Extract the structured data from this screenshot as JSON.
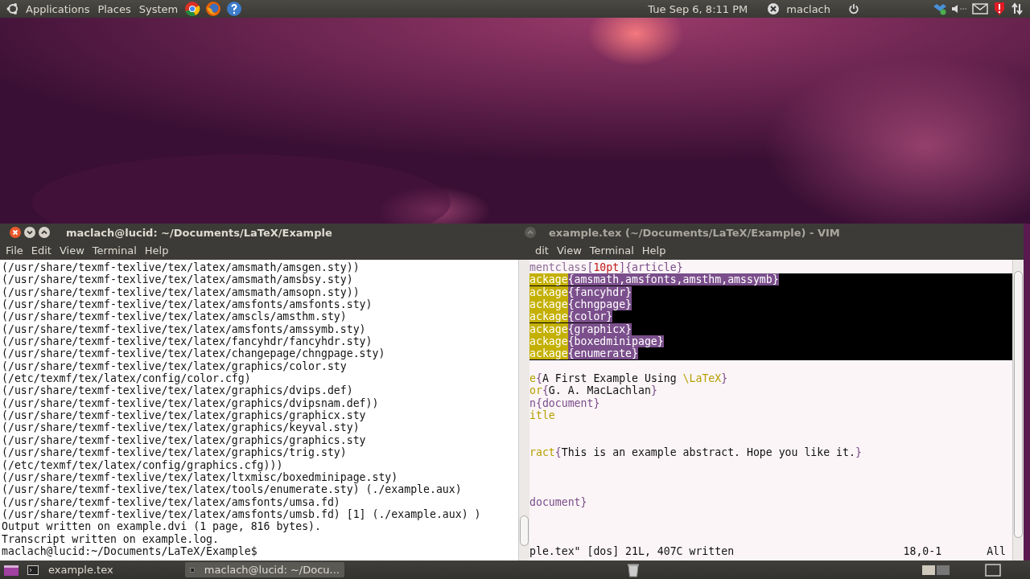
{
  "top_panel": {
    "menus": [
      "Applications",
      "Places",
      "System"
    ],
    "clock": "Tue Sep  6,  8:11 PM",
    "user": "maclach"
  },
  "terminal": {
    "title": "maclach@lucid: ~/Documents/LaTeX/Example",
    "menu": [
      "File",
      "Edit",
      "View",
      "Terminal",
      "Help"
    ],
    "lines": [
      "(/usr/share/texmf-texlive/tex/latex/amsmath/amsgen.sty))",
      "(/usr/share/texmf-texlive/tex/latex/amsmath/amsbsy.sty)",
      "(/usr/share/texmf-texlive/tex/latex/amsmath/amsopn.sty))",
      "(/usr/share/texmf-texlive/tex/latex/amsfonts/amsfonts.sty)",
      "(/usr/share/texmf-texlive/tex/latex/amscls/amsthm.sty)",
      "(/usr/share/texmf-texlive/tex/latex/amsfonts/amssymb.sty)",
      "(/usr/share/texmf-texlive/tex/latex/fancyhdr/fancyhdr.sty)",
      "(/usr/share/texmf-texlive/tex/latex/changepage/chngpage.sty)",
      "(/usr/share/texmf-texlive/tex/latex/graphics/color.sty",
      "(/etc/texmf/tex/latex/config/color.cfg)",
      "(/usr/share/texmf-texlive/tex/latex/graphics/dvips.def)",
      "(/usr/share/texmf-texlive/tex/latex/graphics/dvipsnam.def))",
      "(/usr/share/texmf-texlive/tex/latex/graphics/graphicx.sty",
      "(/usr/share/texmf-texlive/tex/latex/graphics/keyval.sty)",
      "(/usr/share/texmf-texlive/tex/latex/graphics/graphics.sty",
      "(/usr/share/texmf-texlive/tex/latex/graphics/trig.sty)",
      "(/etc/texmf/tex/latex/config/graphics.cfg)))",
      "(/usr/share/texmf-texlive/tex/latex/ltxmisc/boxedminipage.sty)",
      "(/usr/share/texmf-texlive/tex/latex/tools/enumerate.sty) (./example.aux)",
      "(/usr/share/texmf-texlive/tex/latex/amsfonts/umsa.fd)",
      "(/usr/share/texmf-texlive/tex/latex/amsfonts/umsb.fd) [1] (./example.aux) )",
      "Output written on example.dvi (1 page, 816 bytes).",
      "Transcript written on example.log.",
      "maclach@lucid:~/Documents/LaTeX/Example$"
    ]
  },
  "vim": {
    "title": "example.tex (~/Documents/LaTeX/Example) - VIM",
    "menu": [
      "dit",
      "View",
      "Terminal",
      "Help"
    ],
    "lines": [
      {
        "kind": "code",
        "segments": [
          {
            "text": "mentclass",
            "kind": "special"
          },
          {
            "text": "[",
            "kind": "delim"
          },
          {
            "text": "10pt",
            "kind": "number"
          },
          {
            "text": "]{article}",
            "kind": "delim"
          }
        ]
      },
      {
        "kind": "highlighted",
        "segments": [
          {
            "text": "ackage",
            "kind": "statement"
          },
          {
            "text": "{amsmath,amsfonts,amsthm,amssymb}",
            "kind": "delim"
          }
        ]
      },
      {
        "kind": "highlighted",
        "segments": [
          {
            "text": "ackage",
            "kind": "statement"
          },
          {
            "text": "{fancyhdr}",
            "kind": "delim"
          }
        ]
      },
      {
        "kind": "highlighted",
        "segments": [
          {
            "text": "ackage",
            "kind": "statement"
          },
          {
            "text": "{chngpage}",
            "kind": "delim"
          }
        ]
      },
      {
        "kind": "highlighted",
        "segments": [
          {
            "text": "ackage",
            "kind": "statement"
          },
          {
            "text": "{color}",
            "kind": "delim"
          }
        ]
      },
      {
        "kind": "highlighted",
        "segments": [
          {
            "text": "ackage",
            "kind": "statement"
          },
          {
            "text": "{graphicx}",
            "kind": "delim"
          }
        ]
      },
      {
        "kind": "highlighted",
        "segments": [
          {
            "text": "ackage",
            "kind": "statement"
          },
          {
            "text": "{boxedminipage}",
            "kind": "delim"
          }
        ]
      },
      {
        "kind": "highlighted",
        "segments": [
          {
            "text": "ackage",
            "kind": "statement"
          },
          {
            "text": "{enumerate}",
            "kind": "delim"
          }
        ]
      },
      {
        "kind": "blank"
      },
      {
        "kind": "code",
        "segments": [
          {
            "text": "e",
            "kind": "statement"
          },
          {
            "text": "{",
            "kind": "delim"
          },
          {
            "text": "A First Example Using ",
            "kind": "plain"
          },
          {
            "text": "\\LaTeX",
            "kind": "statement"
          },
          {
            "text": "}",
            "kind": "delim"
          }
        ]
      },
      {
        "kind": "code",
        "segments": [
          {
            "text": "or",
            "kind": "statement"
          },
          {
            "text": "{",
            "kind": "delim"
          },
          {
            "text": "G. A. MacLachlan",
            "kind": "plain"
          },
          {
            "text": "}",
            "kind": "delim"
          }
        ]
      },
      {
        "kind": "code",
        "segments": [
          {
            "text": "n{document}",
            "kind": "delim"
          }
        ]
      },
      {
        "kind": "code",
        "segments": [
          {
            "text": "itle",
            "kind": "statement"
          }
        ]
      },
      {
        "kind": "blank"
      },
      {
        "kind": "blank"
      },
      {
        "kind": "code",
        "segments": [
          {
            "text": "ract",
            "kind": "statement"
          },
          {
            "text": "{",
            "kind": "delim"
          },
          {
            "text": "This is an example abstract. Hope you like it.",
            "kind": "plain"
          },
          {
            "text": "}",
            "kind": "delim"
          }
        ]
      },
      {
        "kind": "blank"
      },
      {
        "kind": "blank"
      },
      {
        "kind": "blank"
      },
      {
        "kind": "code",
        "segments": [
          {
            "text": "document}",
            "kind": "delim"
          }
        ]
      },
      {
        "kind": "blank"
      },
      {
        "kind": "blank"
      },
      {
        "kind": "blank"
      }
    ],
    "status": {
      "message": "ple.tex\" [dos] 21L, 407C written",
      "position": "18,0-1",
      "scroll": "All"
    }
  },
  "taskbar": {
    "tasks": [
      {
        "label": "example.tex",
        "selected": false
      },
      {
        "label": "maclach@lucid: ~/Docu...",
        "selected": true
      }
    ],
    "workspaces": [
      {
        "selected": true
      },
      {
        "selected": false
      }
    ]
  }
}
